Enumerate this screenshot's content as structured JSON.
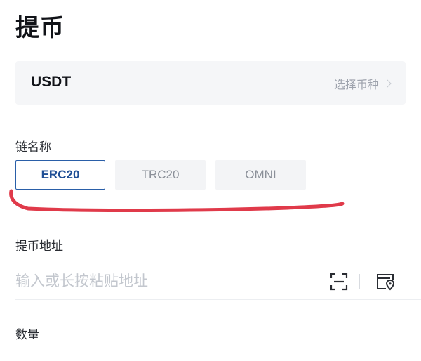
{
  "page": {
    "title": "提币"
  },
  "coin": {
    "symbol": "USDT",
    "select_label": "选择币种"
  },
  "chain": {
    "label": "链名称",
    "options": [
      "ERC20",
      "TRC20",
      "OMNI"
    ],
    "selected": "ERC20"
  },
  "address": {
    "label": "提币地址",
    "placeholder": "输入或长按粘贴地址",
    "value": "",
    "icons": [
      "scan-icon",
      "address-book-icon"
    ]
  },
  "quantity": {
    "label": "数量"
  },
  "colors": {
    "accent": "#2a5fa8",
    "annotation": "#e03a4a",
    "muted": "#9ea3ad",
    "box_bg": "#f5f6f8"
  }
}
